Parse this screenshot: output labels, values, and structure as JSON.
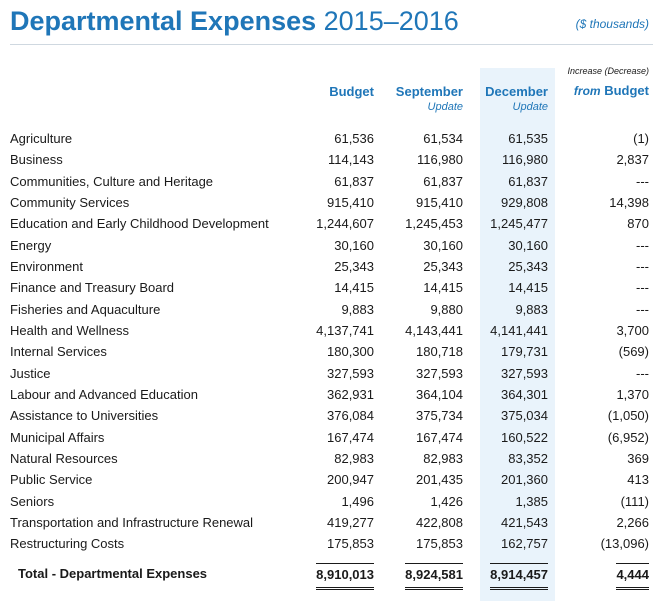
{
  "title": {
    "bold": "Departmental Expenses",
    "years": "2015–2016"
  },
  "units": "($ thousands)",
  "headers": {
    "budget": "Budget",
    "september": {
      "main": "September",
      "sub": "Update"
    },
    "december": {
      "main": "December",
      "sub": "Update"
    },
    "increase": {
      "top": "Increase (Decrease)",
      "from": "from",
      "budget": "Budget"
    }
  },
  "rows": [
    {
      "name": "Agriculture",
      "budget": "61,536",
      "september": "61,534",
      "december": "61,535",
      "change": "(1)"
    },
    {
      "name": "Business",
      "budget": "114,143",
      "september": "116,980",
      "december": "116,980",
      "change": "2,837"
    },
    {
      "name": "Communities, Culture and Heritage",
      "budget": "61,837",
      "september": "61,837",
      "december": "61,837",
      "change": "---"
    },
    {
      "name": "Community Services",
      "budget": "915,410",
      "september": "915,410",
      "december": "929,808",
      "change": "14,398"
    },
    {
      "name": "Education and Early Childhood Development",
      "budget": "1,244,607",
      "september": "1,245,453",
      "december": "1,245,477",
      "change": "870"
    },
    {
      "name": "Energy",
      "budget": "30,160",
      "september": "30,160",
      "december": "30,160",
      "change": "---"
    },
    {
      "name": "Environment",
      "budget": "25,343",
      "september": "25,343",
      "december": "25,343",
      "change": "---"
    },
    {
      "name": "Finance and Treasury Board",
      "budget": "14,415",
      "september": "14,415",
      "december": "14,415",
      "change": "---"
    },
    {
      "name": "Fisheries and Aquaculture",
      "budget": "9,883",
      "september": "9,880",
      "december": "9,883",
      "change": "---"
    },
    {
      "name": "Health and Wellness",
      "budget": "4,137,741",
      "september": "4,143,441",
      "december": "4,141,441",
      "change": "3,700"
    },
    {
      "name": "Internal Services",
      "budget": "180,300",
      "september": "180,718",
      "december": "179,731",
      "change": "(569)"
    },
    {
      "name": "Justice",
      "budget": "327,593",
      "september": "327,593",
      "december": "327,593",
      "change": "---"
    },
    {
      "name": "Labour and Advanced Education",
      "budget": "362,931",
      "september": "364,104",
      "december": "364,301",
      "change": "1,370"
    },
    {
      "name": "Assistance to Universities",
      "budget": "376,084",
      "september": "375,734",
      "december": "375,034",
      "change": "(1,050)"
    },
    {
      "name": "Municipal Affairs",
      "budget": "167,474",
      "september": "167,474",
      "december": "160,522",
      "change": "(6,952)"
    },
    {
      "name": "Natural Resources",
      "budget": "82,983",
      "september": "82,983",
      "december": "83,352",
      "change": "369"
    },
    {
      "name": "Public Service",
      "budget": "200,947",
      "september": "201,435",
      "december": "201,360",
      "change": "413"
    },
    {
      "name": "Seniors",
      "budget": "1,496",
      "september": "1,426",
      "december": "1,385",
      "change": "(111)"
    },
    {
      "name": "Transportation and Infrastructure Renewal",
      "budget": "419,277",
      "september": "422,808",
      "december": "421,543",
      "change": "2,266"
    },
    {
      "name": "Restructuring Costs",
      "budget": "175,853",
      "september": "175,853",
      "december": "162,757",
      "change": "(13,096)"
    }
  ],
  "total": {
    "name": "Total - Departmental Expenses",
    "budget": "8,910,013",
    "september": "8,924,581",
    "december": "8,914,457",
    "change": "4,444"
  }
}
